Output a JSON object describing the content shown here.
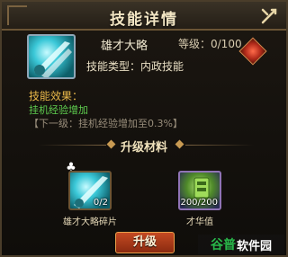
{
  "window": {
    "title": "技能详情"
  },
  "skill": {
    "name": "雄才大略",
    "level_text": "等级：0/100",
    "type_text": "技能类型：内政技能",
    "icon": "sword-slash-icon"
  },
  "effect": {
    "heading": "技能效果：",
    "description": "挂机经验增加",
    "next_level": "【下一级：挂机经验增加至0.3%】"
  },
  "materials": {
    "heading": "升级材料",
    "items": [
      {
        "name": "雄才大略碎片",
        "count": "0/2",
        "icon": "skill-fragment-icon",
        "badge": "fragment-badge-icon"
      },
      {
        "name": "才华值",
        "count": "200/200",
        "icon": "talent-points-icon"
      }
    ]
  },
  "actions": {
    "upgrade_label": "升级"
  },
  "watermark": {
    "brand_green": "谷普",
    "brand_white": "软件园"
  },
  "colors": {
    "accent_gold": "#e9b84a",
    "effect_green": "#5fcf4f",
    "button_red": "#c44a22"
  }
}
